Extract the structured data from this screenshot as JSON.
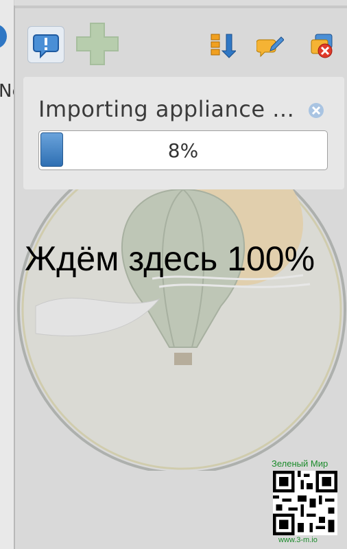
{
  "left_fragment": {
    "text": "Ne"
  },
  "progress": {
    "title": "Importing appliance ...",
    "percent_label": "8%",
    "fraction": 0.08
  },
  "caption": "Ждём здесь 100%",
  "watermark": {
    "title": "Зеленый Мир",
    "url": "www.3-m.io"
  },
  "icons": {
    "notify": "notification-icon",
    "add": "plus-icon",
    "sort": "sort-down-icon",
    "edit": "pen-icon",
    "delete": "delete-icon",
    "cancel": "close-icon"
  },
  "colors": {
    "accent": "#2e6fb3",
    "watermark": "#1a8a2a"
  }
}
